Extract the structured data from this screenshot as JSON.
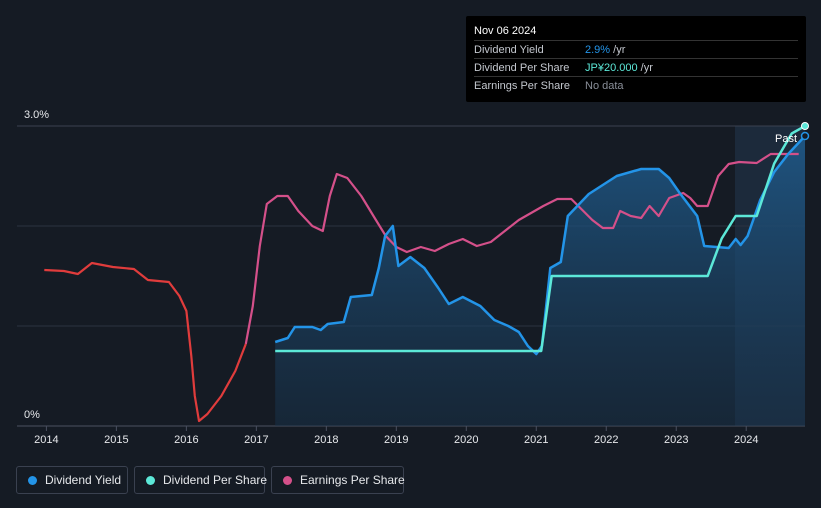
{
  "tooltip": {
    "date": "Nov 06 2024",
    "rows": [
      {
        "label": "Dividend Yield",
        "value": "2.9%",
        "unit": " /yr"
      },
      {
        "label": "Dividend Per Share",
        "value": "JP¥20.000",
        "unit": " /yr"
      },
      {
        "label": "Earnings Per Share",
        "value": "No data",
        "unit": ""
      }
    ]
  },
  "legend": [
    {
      "label": "Dividend Yield",
      "color": "#2394e8"
    },
    {
      "label": "Dividend Per Share",
      "color": "#5ce8d8"
    },
    {
      "label": "Earnings Per Share",
      "color": "#d4508a"
    }
  ],
  "past_label": "Past",
  "colors": {
    "background": "#151b24",
    "yield": "#2394e8",
    "dps": "#5ce8d8",
    "eps_pos": "#d4508a",
    "eps_neg": "#e03c3c",
    "grid": "#2c3340"
  },
  "chart_data": {
    "type": "line",
    "y_ticks": [
      "3.0%",
      "0%"
    ],
    "y_range_percent": [
      0,
      3.0
    ],
    "x_range": [
      2013.58,
      2024.84
    ],
    "x_ticks": [
      "2014",
      "2015",
      "2016",
      "2017",
      "2018",
      "2019",
      "2020",
      "2021",
      "2022",
      "2023",
      "2024"
    ],
    "past_region_start": 2023.84,
    "series": [
      {
        "name": "Dividend Yield",
        "units": "% per year",
        "points": [
          [
            2017.27,
            0.84
          ],
          [
            2017.45,
            0.88
          ],
          [
            2017.55,
            0.99
          ],
          [
            2017.8,
            0.99
          ],
          [
            2017.92,
            0.96
          ],
          [
            2018.02,
            1.02
          ],
          [
            2018.25,
            1.04
          ],
          [
            2018.35,
            1.29
          ],
          [
            2018.65,
            1.31
          ],
          [
            2018.75,
            1.58
          ],
          [
            2018.84,
            1.9
          ],
          [
            2018.95,
            2.0
          ],
          [
            2019.03,
            1.6
          ],
          [
            2019.2,
            1.69
          ],
          [
            2019.4,
            1.58
          ],
          [
            2019.6,
            1.38
          ],
          [
            2019.75,
            1.22
          ],
          [
            2019.95,
            1.29
          ],
          [
            2020.2,
            1.2
          ],
          [
            2020.4,
            1.06
          ],
          [
            2020.6,
            1.0
          ],
          [
            2020.75,
            0.94
          ],
          [
            2020.88,
            0.8
          ],
          [
            2021.0,
            0.72
          ],
          [
            2021.08,
            0.8
          ],
          [
            2021.2,
            1.58
          ],
          [
            2021.35,
            1.64
          ],
          [
            2021.45,
            2.1
          ],
          [
            2021.75,
            2.32
          ],
          [
            2022.15,
            2.5
          ],
          [
            2022.5,
            2.57
          ],
          [
            2022.75,
            2.57
          ],
          [
            2022.9,
            2.48
          ],
          [
            2023.05,
            2.33
          ],
          [
            2023.3,
            2.1
          ],
          [
            2023.4,
            1.8
          ],
          [
            2023.75,
            1.78
          ],
          [
            2023.85,
            1.87
          ],
          [
            2023.92,
            1.81
          ],
          [
            2024.02,
            1.9
          ],
          [
            2024.2,
            2.26
          ],
          [
            2024.4,
            2.54
          ],
          [
            2024.6,
            2.72
          ],
          [
            2024.84,
            2.9
          ]
        ]
      },
      {
        "name": "Dividend Per Share",
        "units": "JP¥",
        "points": [
          [
            2017.27,
            5.0
          ],
          [
            2021.07,
            5.0
          ],
          [
            2021.22,
            10.0
          ],
          [
            2023.45,
            10.0
          ],
          [
            2023.65,
            12.5
          ],
          [
            2023.85,
            14.0
          ],
          [
            2024.15,
            14.0
          ],
          [
            2024.4,
            17.5
          ],
          [
            2024.65,
            19.5
          ],
          [
            2024.84,
            20.0
          ]
        ]
      },
      {
        "name": "Earnings Per Share",
        "points": [
          [
            2013.97,
            1.56
          ],
          [
            2014.25,
            1.55
          ],
          [
            2014.45,
            1.52
          ],
          [
            2014.65,
            1.63
          ],
          [
            2014.95,
            1.59
          ],
          [
            2015.25,
            1.57
          ],
          [
            2015.45,
            1.46
          ],
          [
            2015.75,
            1.44
          ],
          [
            2015.9,
            1.3
          ],
          [
            2016.0,
            1.15
          ],
          [
            2016.07,
            0.7
          ],
          [
            2016.12,
            0.3
          ],
          [
            2016.18,
            0.05
          ],
          [
            2016.3,
            0.12
          ],
          [
            2016.5,
            0.3
          ],
          [
            2016.7,
            0.55
          ],
          [
            2016.85,
            0.82
          ],
          [
            2016.95,
            1.2
          ],
          [
            2017.05,
            1.8
          ],
          [
            2017.15,
            2.22
          ],
          [
            2017.3,
            2.3
          ],
          [
            2017.45,
            2.3
          ],
          [
            2017.6,
            2.15
          ],
          [
            2017.8,
            2.0
          ],
          [
            2017.95,
            1.95
          ],
          [
            2018.05,
            2.3
          ],
          [
            2018.15,
            2.52
          ],
          [
            2018.3,
            2.48
          ],
          [
            2018.5,
            2.3
          ],
          [
            2018.7,
            2.07
          ],
          [
            2018.85,
            1.9
          ],
          [
            2019.0,
            1.79
          ],
          [
            2019.15,
            1.74
          ],
          [
            2019.35,
            1.79
          ],
          [
            2019.55,
            1.75
          ],
          [
            2019.75,
            1.82
          ],
          [
            2019.95,
            1.87
          ],
          [
            2020.15,
            1.8
          ],
          [
            2020.35,
            1.84
          ],
          [
            2020.55,
            1.95
          ],
          [
            2020.75,
            2.06
          ],
          [
            2020.95,
            2.14
          ],
          [
            2021.1,
            2.2
          ],
          [
            2021.3,
            2.27
          ],
          [
            2021.5,
            2.27
          ],
          [
            2021.6,
            2.2
          ],
          [
            2021.8,
            2.06
          ],
          [
            2021.95,
            1.98
          ],
          [
            2022.1,
            1.98
          ],
          [
            2022.2,
            2.15
          ],
          [
            2022.35,
            2.1
          ],
          [
            2022.5,
            2.08
          ],
          [
            2022.62,
            2.2
          ],
          [
            2022.75,
            2.1
          ],
          [
            2022.9,
            2.28
          ],
          [
            2023.1,
            2.33
          ],
          [
            2023.2,
            2.28
          ],
          [
            2023.3,
            2.2
          ],
          [
            2023.45,
            2.2
          ],
          [
            2023.6,
            2.5
          ],
          [
            2023.75,
            2.62
          ],
          [
            2023.9,
            2.64
          ],
          [
            2024.15,
            2.63
          ],
          [
            2024.35,
            2.72
          ],
          [
            2024.6,
            2.72
          ],
          [
            2024.75,
            2.72
          ]
        ]
      }
    ]
  }
}
